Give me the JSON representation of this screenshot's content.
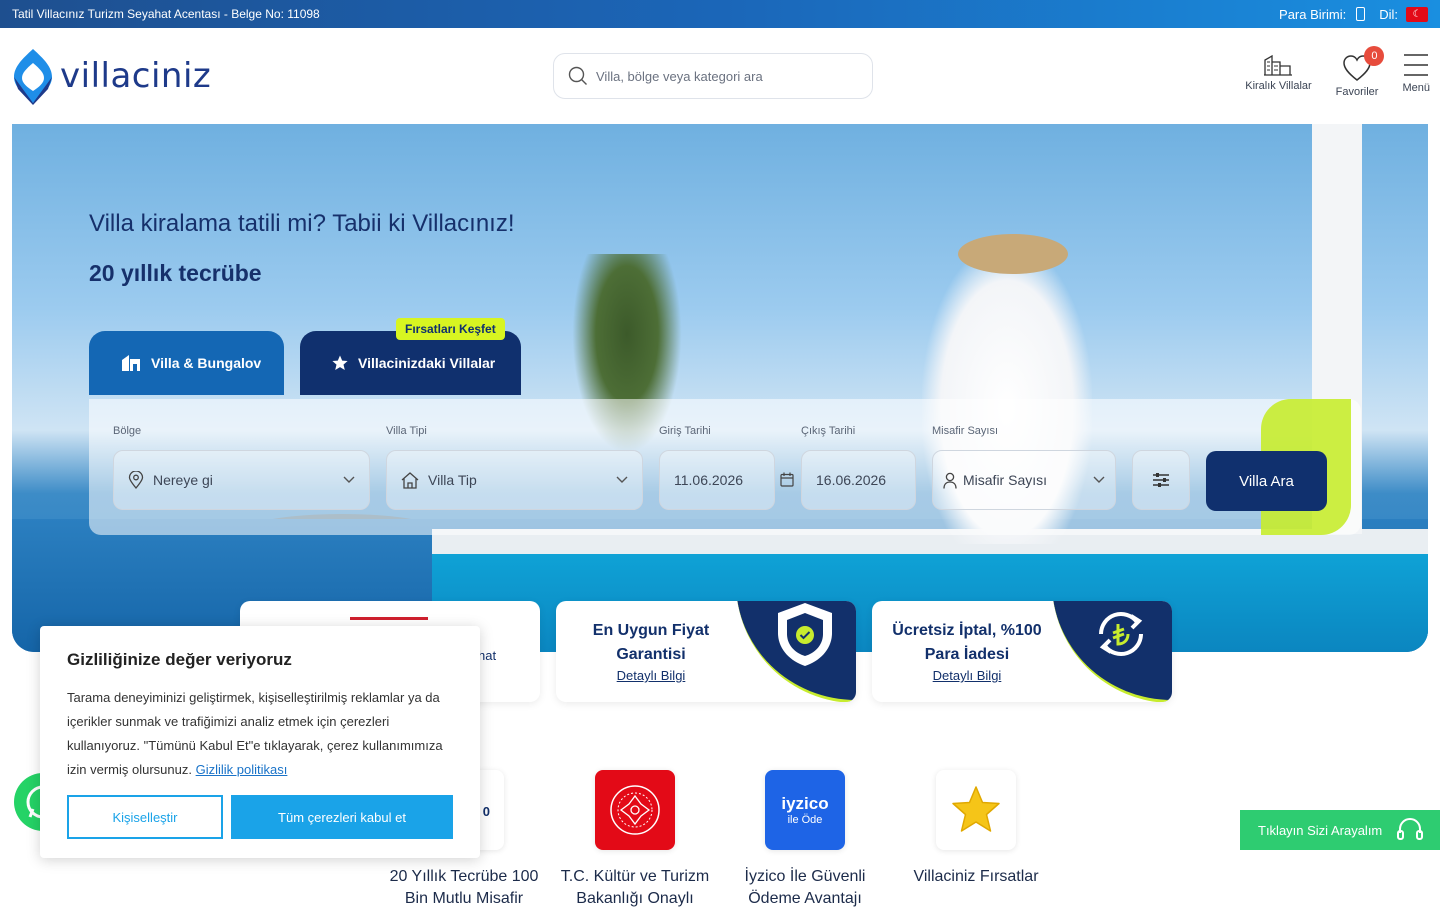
{
  "topbar": {
    "agency": "Tatil Villacınız Turizm Seyahat Acentası - Belge No: 11098",
    "currency_label": "Para Birimi:",
    "language_label": "Dil:"
  },
  "header": {
    "logo_text": "villaciniz",
    "search_placeholder": "Villa, bölge veya kategori ara",
    "links": {
      "rentals": "Kiralık Villalar",
      "favorites": "Favoriler",
      "favorites_count": "0",
      "menu": "Menü"
    }
  },
  "hero": {
    "title": "Villa kiralama tatili mi? Tabii ki Villacınız!",
    "subtitle": "20 yıllık tecrübe",
    "tabs": {
      "villa": "Villa & Bungalov",
      "deals": "Villacinizdaki Villalar"
    },
    "deal_badge": "Fırsatları Keşfet"
  },
  "search_form": {
    "region_label": "Bölge",
    "region_placeholder": "Nereye gi",
    "type_label": "Villa Tipi",
    "type_placeholder": "Villa Tip",
    "checkin_label": "Giriş Tarihi",
    "checkin_value": "11.06.2026",
    "checkout_label": "Çıkış Tarihi",
    "checkout_value": "16.06.2026",
    "guests_label": "Misafir Sayısı",
    "guests_placeholder": "Misafir Sayısı",
    "search_button": "Villa Ara"
  },
  "features": [
    {
      "title": "",
      "link": "",
      "partial": "hat"
    },
    {
      "title": "En Uygun Fiyat Garantisi",
      "link": "Detaylı Bilgi"
    },
    {
      "title": "Ücretsiz İptal, %100 Para İadesi",
      "link": "Detaylı Bilgi"
    }
  ],
  "badges": [
    {
      "caption": "20 Yıllık Tecrübe 100 Bin Mutlu Misafir"
    },
    {
      "caption": "T.C. Kültür ve Turizm Bakanlığı Onaylı"
    },
    {
      "caption": "İyzico İle Güvenli Ödeme Avantajı",
      "logo_main": "iyzico",
      "logo_sub": "ile Öde"
    },
    {
      "caption": "Villaciniz Fırsatlar"
    }
  ],
  "cookie": {
    "title": "Gizliliğinize değer veriyoruz",
    "body": "Tarama deneyiminizi geliştirmek, kişiselleştirilmiş reklamlar ya da içerikler sunmak ve trafiğimizi analiz etmek için çerezleri kullanıyoruz. \"Tümünü Kabul Et\"e tıklayarak, çerez kullanımımıza izin vermiş olursunuz.",
    "link": "Gizlilik politikası",
    "customize_button": "Kişiselleştir",
    "accept_button": "Tüm çerezleri kabul et"
  },
  "call_widget": {
    "label": "Tıklayın Sizi Arayalım"
  },
  "colors": {
    "navy": "#10306e",
    "blue": "#1467b4",
    "lime": "#c7ec2e",
    "cookie_blue": "#1aa3e8",
    "green": "#2ecc71"
  }
}
